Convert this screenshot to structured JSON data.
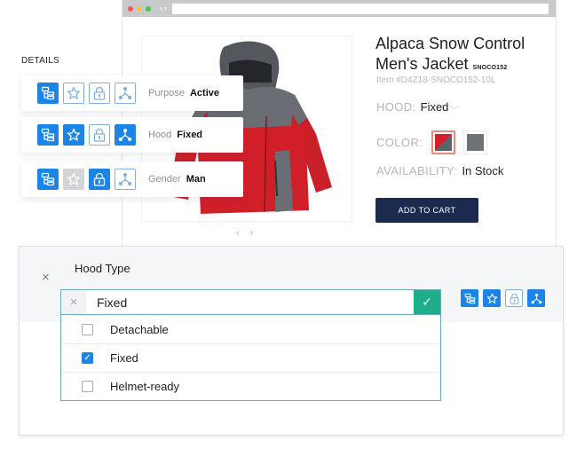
{
  "browser": {
    "window_controls": [
      "close",
      "minimize",
      "maximize"
    ],
    "nav_back_icon": "‹",
    "nav_forward_icon": "›"
  },
  "product": {
    "title": "Alpaca Snow Control Men's Jacket",
    "sku": "SNOCO152",
    "item_number": "Item #D4Z18-SNOCO152-10L",
    "hood_label": "HOOD:",
    "hood_value": "Fixed",
    "color_label": "COLOR:",
    "colors": [
      {
        "name": "red-grey",
        "primary": "#d41f2a",
        "secondary": "#5d636b",
        "selected": true
      },
      {
        "name": "grey",
        "primary": "#707376",
        "selected": false
      }
    ],
    "availability_label": "AVAILABILITY:",
    "availability_value": "In Stock",
    "add_to_cart_label": "ADD TO CART",
    "gallery_nav": "‹ ›"
  },
  "details": {
    "heading": "DETAILS",
    "cards": [
      {
        "label": "Purpose",
        "value": "Active",
        "icon_states": [
          "solid",
          "outline",
          "outline",
          "outline"
        ]
      },
      {
        "label": "Hood",
        "value": "Fixed",
        "icon_states": [
          "solid",
          "solid",
          "outline",
          "solid"
        ]
      },
      {
        "label": "Gender",
        "value": "Man",
        "icon_states": [
          "solid",
          "grey",
          "solid",
          "outline"
        ]
      }
    ]
  },
  "editor": {
    "title": "Hood Type",
    "close_icon": "×",
    "clear_icon": "×",
    "selected_value": "Fixed",
    "confirm_icon": "✓",
    "icon_states": [
      "solid",
      "solid",
      "outline",
      "solid"
    ],
    "options": [
      {
        "label": "Detachable",
        "checked": false
      },
      {
        "label": "Fixed",
        "checked": true
      },
      {
        "label": "Helmet-ready",
        "checked": false
      }
    ]
  },
  "colors": {
    "accent_blue": "#1a85e6",
    "cart_button": "#1b2a4f",
    "confirm_green": "#1fae8a",
    "selected_swatch_border": "#e88a80"
  }
}
